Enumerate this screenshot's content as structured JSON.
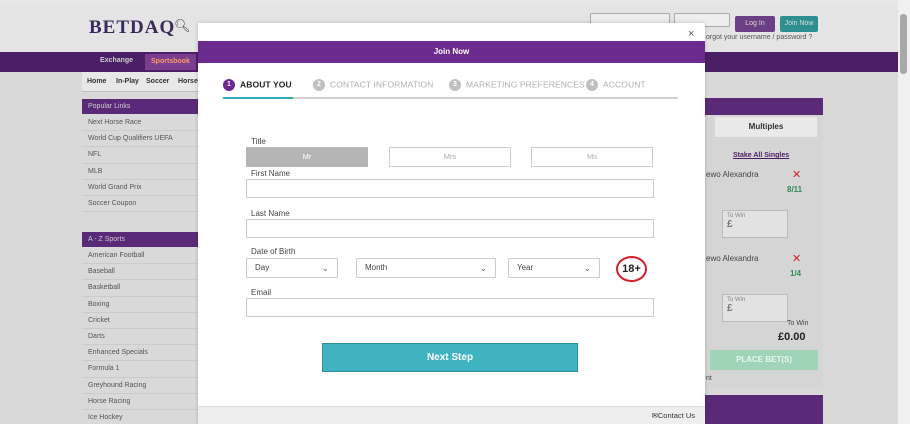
{
  "site": {
    "logo": "BETDAQ",
    "login_label": "Log In",
    "join_label": "Join Now",
    "forgot_text": "orgot your username / password ?"
  },
  "nav": {
    "exchange": "Exchange",
    "sportsbook": "Sportsbook",
    "sub": [
      "Home",
      "In-Play",
      "Soccer",
      "Horse"
    ]
  },
  "popular_links": {
    "header": "Popular Links",
    "items": [
      "Next Horse Race",
      "World Cup Qualifiers UEFA",
      "NFL",
      "MLB",
      "World Grand Prix",
      "Soccer Coupon"
    ]
  },
  "az_sports": {
    "header": "A - Z Sports",
    "items": [
      "American Football",
      "Baseball",
      "Basketball",
      "Boxing",
      "Cricket",
      "Darts",
      "Enhanced Specials",
      "Formula 1",
      "Greyhound Racing",
      "Horse Racing",
      "Ice Hockey"
    ]
  },
  "betslip": {
    "multiples": "Multiples",
    "stake_all": "Stake All Singles",
    "sel1_name": "ewo Alexandra",
    "sel1_odds": "8/11",
    "sel2_name": "ewo Alexandra",
    "sel2_odds": "1/4",
    "to_win_label": "To Win",
    "currency": "£",
    "to_win_value": "£0.00",
    "place_bet": "PLACE BET(S)",
    "nt": "nt"
  },
  "modal": {
    "close": "×",
    "title": "Join Now",
    "steps": [
      {
        "num": "1",
        "label": "ABOUT YOU"
      },
      {
        "num": "2",
        "label": "CONTACT INFORMATION"
      },
      {
        "num": "3",
        "label": "MARKETING PREFERENCES"
      },
      {
        "num": "4",
        "label": "ACCOUNT"
      }
    ],
    "title_label": "Title",
    "title_options": [
      "Mr",
      "Mrs",
      "Ms"
    ],
    "title_selected": "Mr",
    "first_name_label": "First Name",
    "first_name_value": "",
    "last_name_label": "Last Name",
    "last_name_value": "",
    "dob_label": "Date of Birth",
    "dob_day": "Day",
    "dob_month": "Month",
    "dob_year": "Year",
    "age_badge": "18+",
    "email_label": "Email",
    "email_value": "",
    "next_button": "Next Step",
    "contact": "Contact Us"
  },
  "colors": {
    "brand_purple": "#6b2a8e",
    "accent_teal": "#3fb3bf",
    "age_red": "#d61f26"
  }
}
